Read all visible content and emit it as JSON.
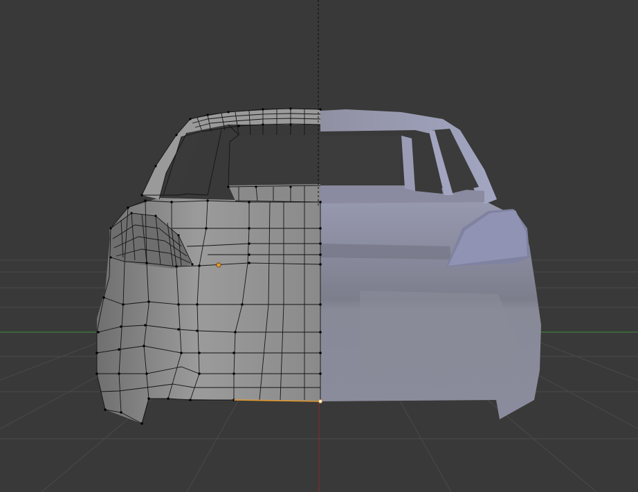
{
  "viewport": {
    "background_color": "#393939",
    "mode": "edit-mode",
    "object": "car-body-mesh"
  },
  "colors": {
    "grid_line": "#4a4a4a",
    "x_axis": "#7f2f2f",
    "y_axis": "#3f7f3f",
    "mirror_axis": "#0a0a0a",
    "wire_edge": "#141414",
    "vertex": "#000000",
    "selected_edge": "#e39a2e",
    "selected_vertex": "#e39a2e",
    "mesh_left_face": "#8e8e8e",
    "mesh_right_face": "#8a8ca2"
  },
  "icons": {
    "cursor": "3d-cursor-icon",
    "vertex": "vertex-dot-icon"
  }
}
